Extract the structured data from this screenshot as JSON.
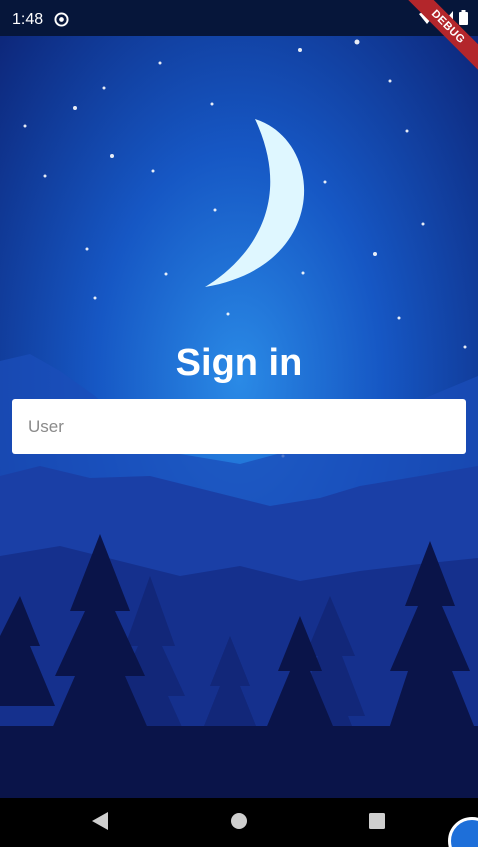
{
  "status_bar": {
    "time": "1:48",
    "app_icon": "at-sign-circle-icon",
    "wifi_icon": "wifi-icon",
    "signal_icon": "signal-icon",
    "battery_icon": "battery-icon"
  },
  "debug_banner": {
    "label": "DEBUG",
    "color": "#b3262b"
  },
  "login": {
    "title": "Sign in",
    "user_placeholder": "User",
    "user_value": ""
  },
  "nav_bar": {
    "back_icon": "back-triangle-icon",
    "home_icon": "home-circle-icon",
    "recents_icon": "recents-square-icon"
  },
  "colors": {
    "sky_top": "#0b1d6b",
    "sky_glow": "#1f74d6",
    "moon": "#dff7ff",
    "forest": "#0a1449"
  }
}
